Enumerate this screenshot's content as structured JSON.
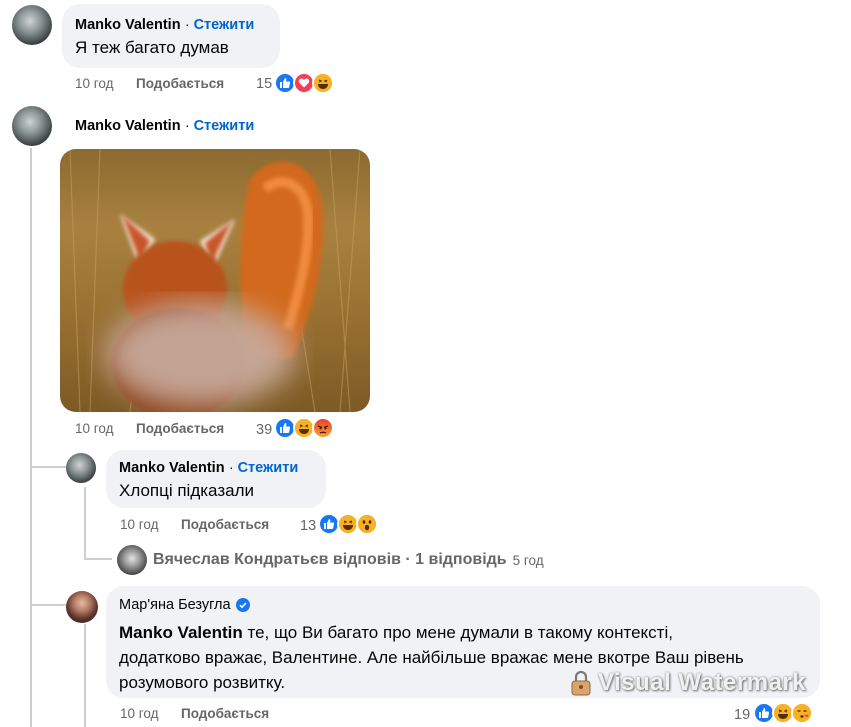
{
  "comments": [
    {
      "author": "Manko Valentin",
      "follow": "Стежити",
      "text": "Я теж багато думав",
      "time": "10 год",
      "like": "Подобається",
      "count": "15"
    },
    {
      "author": "Manko Valentin",
      "follow": "Стежити",
      "time": "10 год",
      "like": "Подобається",
      "count": "39"
    },
    {
      "author": "Manko Valentin",
      "follow": "Стежити",
      "text": "Хлопці підказали",
      "time": "10 год",
      "like": "Подобається",
      "count": "13"
    },
    {
      "author": "Мар'яна Безугла",
      "mention": "Manko Valentin",
      "text_line1": " те, що Ви багато про мене думали в такому контексті,",
      "text_line2": "додатково вражає, Валентине. Але найбільше вражає мене вкотре Ваш рівень",
      "text_line3": "розумового розвитку.",
      "time": "10 год",
      "like": "Подобається",
      "count": "19"
    }
  ],
  "reply_summary": {
    "author": "Вячеслав Кондратьєв",
    "action": " відповів",
    "separator": " · ",
    "count_text": "1 відповідь",
    "time": "5 год"
  },
  "watermark": "Visual Watermark",
  "colors": {
    "link_blue": "#0064d1",
    "bubble": "#f0f2f5",
    "meta_gray": "#65676b",
    "like_blue": "#1877f2"
  }
}
